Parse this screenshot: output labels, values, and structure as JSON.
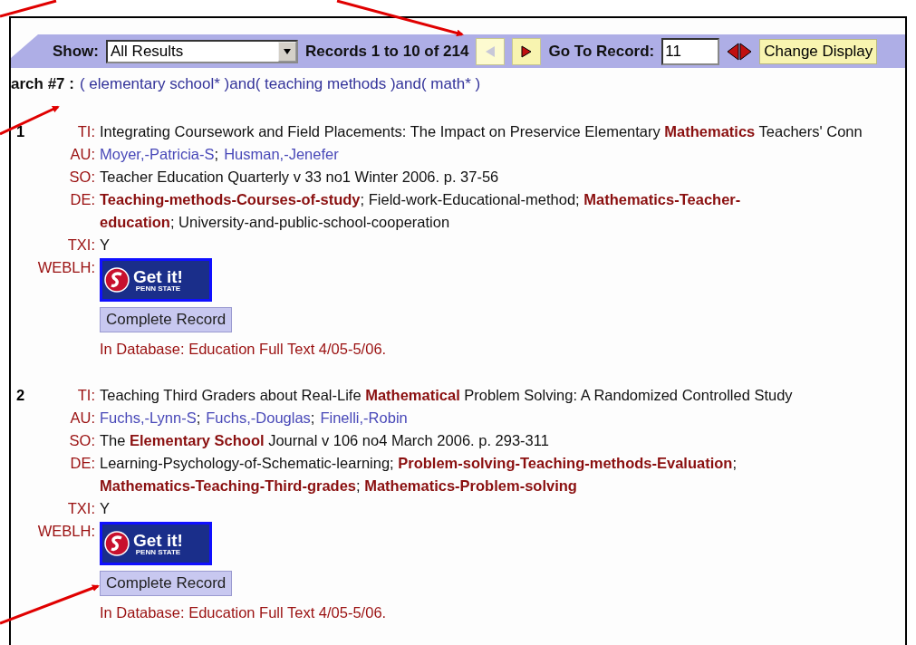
{
  "toolbar": {
    "show_label": "Show:",
    "show_value": "All Results",
    "records": "Records 1 to 10 of 214",
    "prev_disabled": true,
    "next_disabled": false,
    "goto_label": "Go To Record:",
    "goto_value": "11",
    "change_display": "Change Display"
  },
  "search": {
    "label": "arch #7 :",
    "query": "( elementary school* )and( teaching methods )and( math* )"
  },
  "records": [
    {
      "number": "1",
      "fields": [
        {
          "kind": "text",
          "label": "TI:",
          "value": "Integrating Coursework and Field Placements: The Impact on Preservice Elementary **Mathematics** Teachers' Conn"
        },
        {
          "kind": "links",
          "label": "AU:",
          "links": [
            "Moyer,-Patricia-S",
            "Husman,-Jenefer"
          ],
          "separator": ";"
        },
        {
          "kind": "text",
          "label": "SO:",
          "value": "Teacher Education Quarterly v 33 no1 Winter 2006. p. 37-56"
        },
        {
          "kind": "text",
          "label": "DE:",
          "value": "**Teaching-methods-Courses-of-study**; Field-work-Educational-method; **Mathematics-Teacher-education**; University-and-public-school-cooperation"
        },
        {
          "kind": "text",
          "label": "TXI:",
          "value": "Y"
        },
        {
          "kind": "getit",
          "label": "WEBLH:",
          "title": "Get it!",
          "subtitle": "PENN STATE"
        }
      ],
      "button": "Complete Record",
      "database": "In Database: Education Full Text 4/05-5/06."
    },
    {
      "number": "2",
      "fields": [
        {
          "kind": "text",
          "label": "TI:",
          "value": "Teaching Third Graders about Real-Life **Mathematical** Problem Solving: A Randomized Controlled Study"
        },
        {
          "kind": "links",
          "label": "AU:",
          "links": [
            "Fuchs,-Lynn-S",
            "Fuchs,-Douglas",
            "Finelli,-Robin"
          ],
          "separator": ";"
        },
        {
          "kind": "text",
          "label": "SO:",
          "value": "The **Elementary School** Journal v 106 no4 March 2006. p. 293-311"
        },
        {
          "kind": "text",
          "label": "DE:",
          "value": "Learning-Psychology-of-Schematic-learning; **Problem-solving-Teaching-methods-Evaluation**; **Mathematics-Teaching-Third-grades**; **Mathematics-Problem-solving**"
        },
        {
          "kind": "text",
          "label": "TXI:",
          "value": "Y"
        },
        {
          "kind": "getit",
          "label": "WEBLH:",
          "title": "Get it!",
          "subtitle": "PENN STATE"
        }
      ],
      "button": "Complete Record",
      "database": "In Database: Education Full Text 4/05-5/06."
    }
  ]
}
